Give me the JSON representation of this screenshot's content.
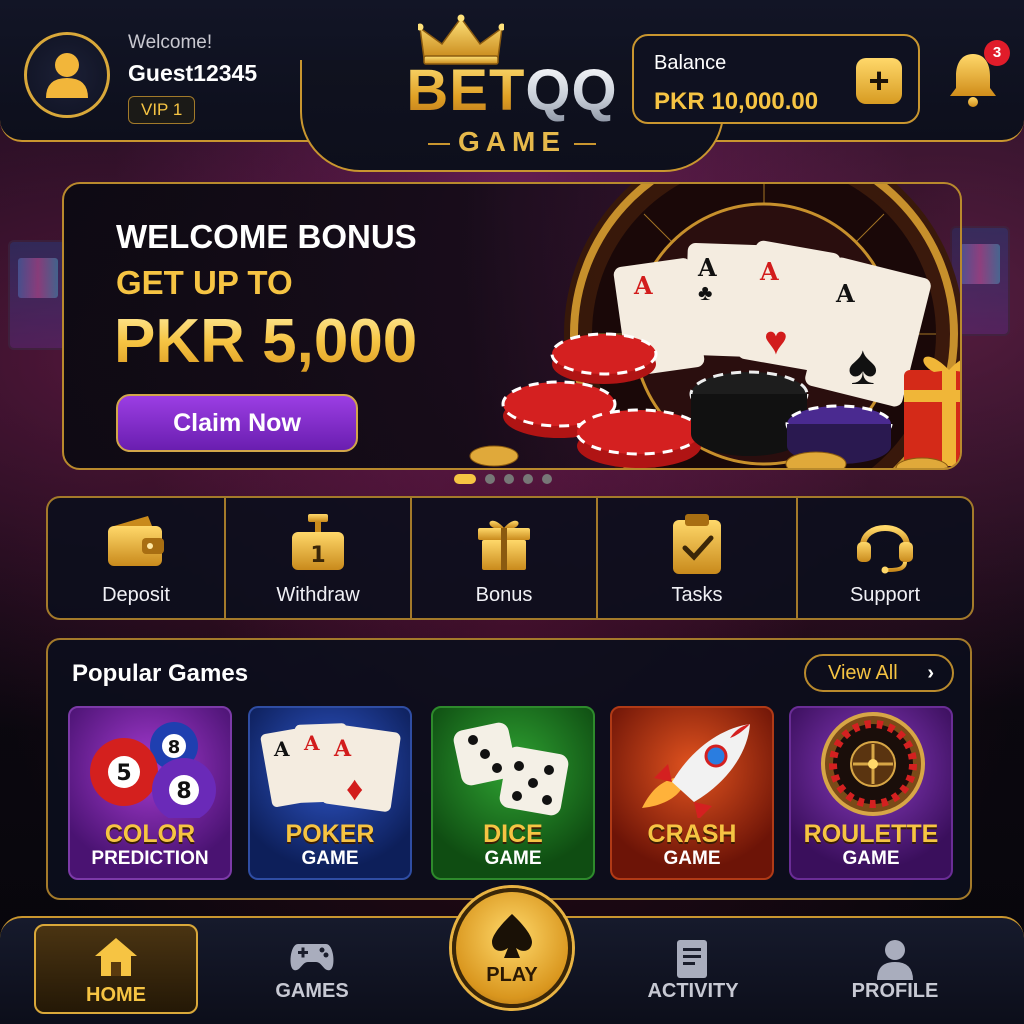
{
  "user": {
    "welcome": "Welcome!",
    "username": "Guest12345",
    "vip": "VIP 1"
  },
  "logo": {
    "brand_part1": "BET",
    "brand_part2": "QQ",
    "subtitle": "GAME"
  },
  "balance": {
    "label": "Balance",
    "value": "PKR 10,000.00",
    "add_symbol": "+"
  },
  "notifications": {
    "count": "3",
    "icon": "bell-icon"
  },
  "banner": {
    "title": "WELCOME BONUS",
    "subtitle": "GET UP TO",
    "amount": "PKR 5,000",
    "cta": "Claim Now",
    "slides_total": 5,
    "active_slide": 1
  },
  "quick_actions": [
    {
      "label": "Deposit",
      "icon": "wallet-icon"
    },
    {
      "label": "Withdraw",
      "icon": "withdraw-icon"
    },
    {
      "label": "Bonus",
      "icon": "gift-icon"
    },
    {
      "label": "Tasks",
      "icon": "clipboard-check-icon"
    },
    {
      "label": "Support",
      "icon": "headset-icon"
    }
  ],
  "popular_games": {
    "title": "Popular Games",
    "view_all": "View All",
    "items": [
      {
        "line1": "COLOR",
        "line2": "PREDICTION"
      },
      {
        "line1": "POKER",
        "line2": "GAME"
      },
      {
        "line1": "DICE",
        "line2": "GAME"
      },
      {
        "line1": "CRASH",
        "line2": "GAME"
      },
      {
        "line1": "ROULETTE",
        "line2": "GAME"
      }
    ]
  },
  "bottom_nav": {
    "home": "HOME",
    "games": "GAMES",
    "play": "PLAY",
    "activity": "ACTIVITY",
    "profile": "PROFILE",
    "active": "home"
  },
  "colors": {
    "gold": "#f6c443",
    "gold_border": "#c9962f",
    "purple_button": "#7a2bc4",
    "badge_red": "#e01c2a",
    "background": "#0b0a14"
  }
}
